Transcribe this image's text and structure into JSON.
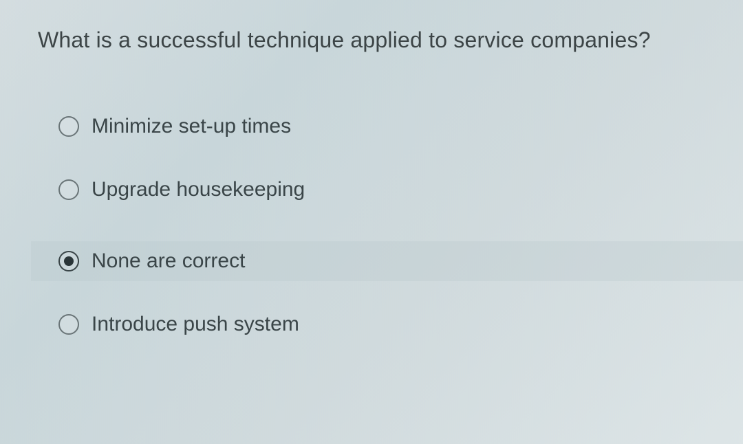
{
  "question": {
    "text": "What is a successful technique applied to service companies?",
    "options": [
      {
        "label": "Minimize set-up times",
        "selected": false
      },
      {
        "label": "Upgrade housekeeping",
        "selected": false
      },
      {
        "label": "None are correct",
        "selected": true
      },
      {
        "label": "Introduce push system",
        "selected": false
      }
    ]
  }
}
